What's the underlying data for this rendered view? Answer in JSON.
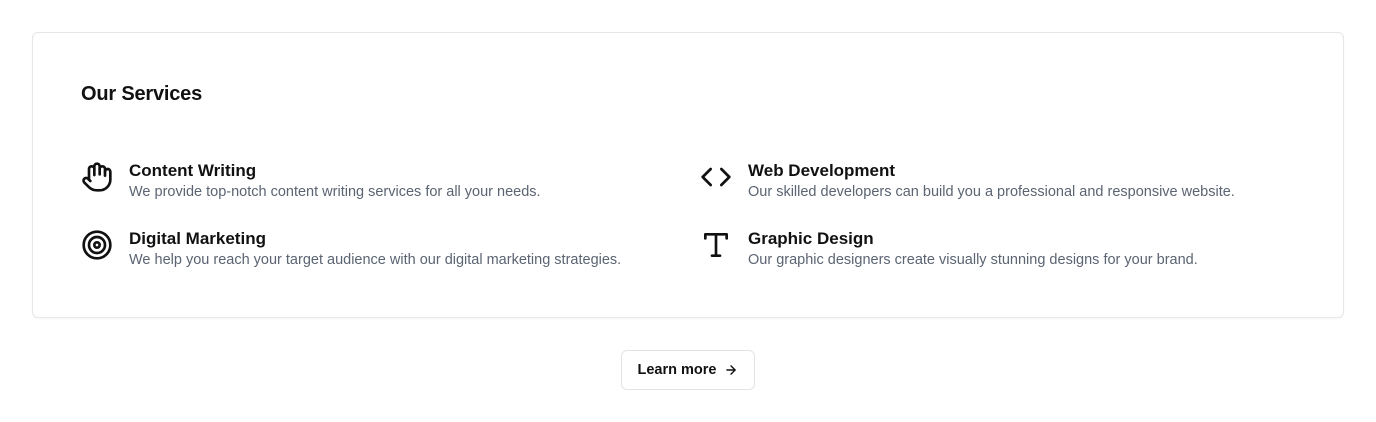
{
  "section": {
    "title": "Our Services"
  },
  "services": [
    {
      "name": "Content Writing",
      "description": "We provide top-notch content writing services for all your needs.",
      "icon": "hand-icon"
    },
    {
      "name": "Web Development",
      "description": "Our skilled developers can build you a professional and responsive website.",
      "icon": "code-icon"
    },
    {
      "name": "Digital Marketing",
      "description": "We help you reach your target audience with our digital marketing strategies.",
      "icon": "target-icon"
    },
    {
      "name": "Graphic Design",
      "description": "Our graphic designers create visually stunning designs for your brand.",
      "icon": "text-type-icon"
    }
  ],
  "cta": {
    "label": "Learn more",
    "icon": "arrow-right-icon"
  },
  "colors": {
    "text": "#111111",
    "muted": "#5b6472",
    "border": "#e6e6e8",
    "background": "#ffffff"
  }
}
